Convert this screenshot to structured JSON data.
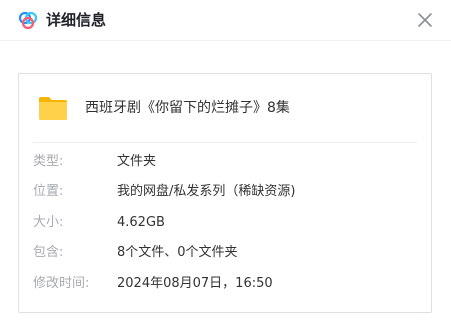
{
  "dialog": {
    "title": "详细信息",
    "logo_icon": "baidu-netdisk-cloud-icon",
    "close_icon": "close-icon"
  },
  "file": {
    "icon": "folder-icon",
    "icon_color": "#ffc53d",
    "name": "西班牙剧《你留下的烂摊子》8集"
  },
  "details": [
    {
      "label": "类型:",
      "value": "文件夹"
    },
    {
      "label": "位置:",
      "value": "我的网盘/私发系列（稀缺资源)"
    },
    {
      "label": "大小:",
      "value": "4.62GB"
    },
    {
      "label": "包含:",
      "value": "8个文件、0个文件夹"
    },
    {
      "label": "修改时间:",
      "value": "2024年08月07日，16:50"
    }
  ]
}
